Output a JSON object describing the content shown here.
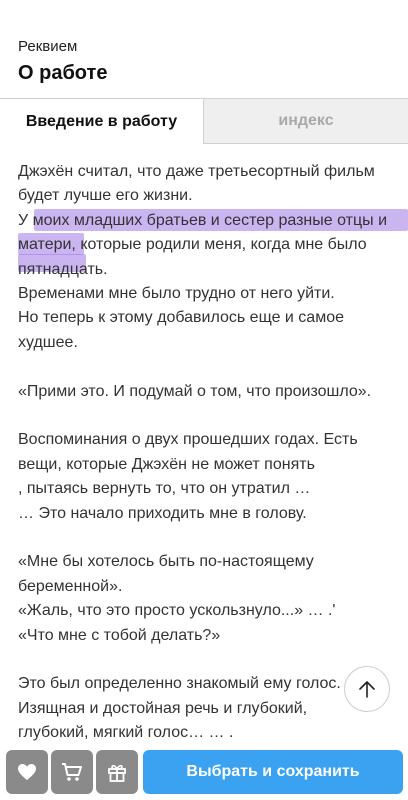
{
  "header": {
    "subtitle": "Реквием",
    "title": "О работе"
  },
  "tabs": [
    {
      "label": "Введение в работу",
      "active": true
    },
    {
      "label": "индекс",
      "active": false
    }
  ],
  "content": {
    "lines": [
      "Джэхён считал, что даже третьесортный фильм",
      "будет лучше его жизни.",
      "У моих младших братьев и сестер разные отцы и",
      "матери, которые родили меня, когда мне было",
      "пятнадцать.",
      "Временами мне было трудно от него уйти.",
      "Но теперь к этому добавилось еще и самое",
      "худшее.",
      "",
      "«Прими это. И подумай о том, что произошло».",
      "",
      "Воспоминания о двух прошедших годах. Есть",
      "вещи, которые Джэхён не может понять",
      ", пытаясь вернуть то, что он утратил …",
      "… Это начало приходить мне в голову.",
      "",
      "«Мне бы хотелось быть по-настоящему",
      "беременной».",
      "«Жаль, что это просто ускользнуло...» … .'",
      "«Что мне с тобой делать?»",
      "",
      "Это был определенно знакомый ему голос.",
      "Изящная и достойная речь и глубокий,",
      "глубокий, мягкий голос… … ."
    ]
  },
  "highlight_color": "#9e78e6",
  "scroll_top_icon": "arrow-up-icon",
  "footer": {
    "icons": [
      "heart-icon",
      "cart-icon",
      "gift-icon"
    ],
    "primary_label": "Выбрать и сохранить",
    "primary_color": "#3ba2f2"
  }
}
